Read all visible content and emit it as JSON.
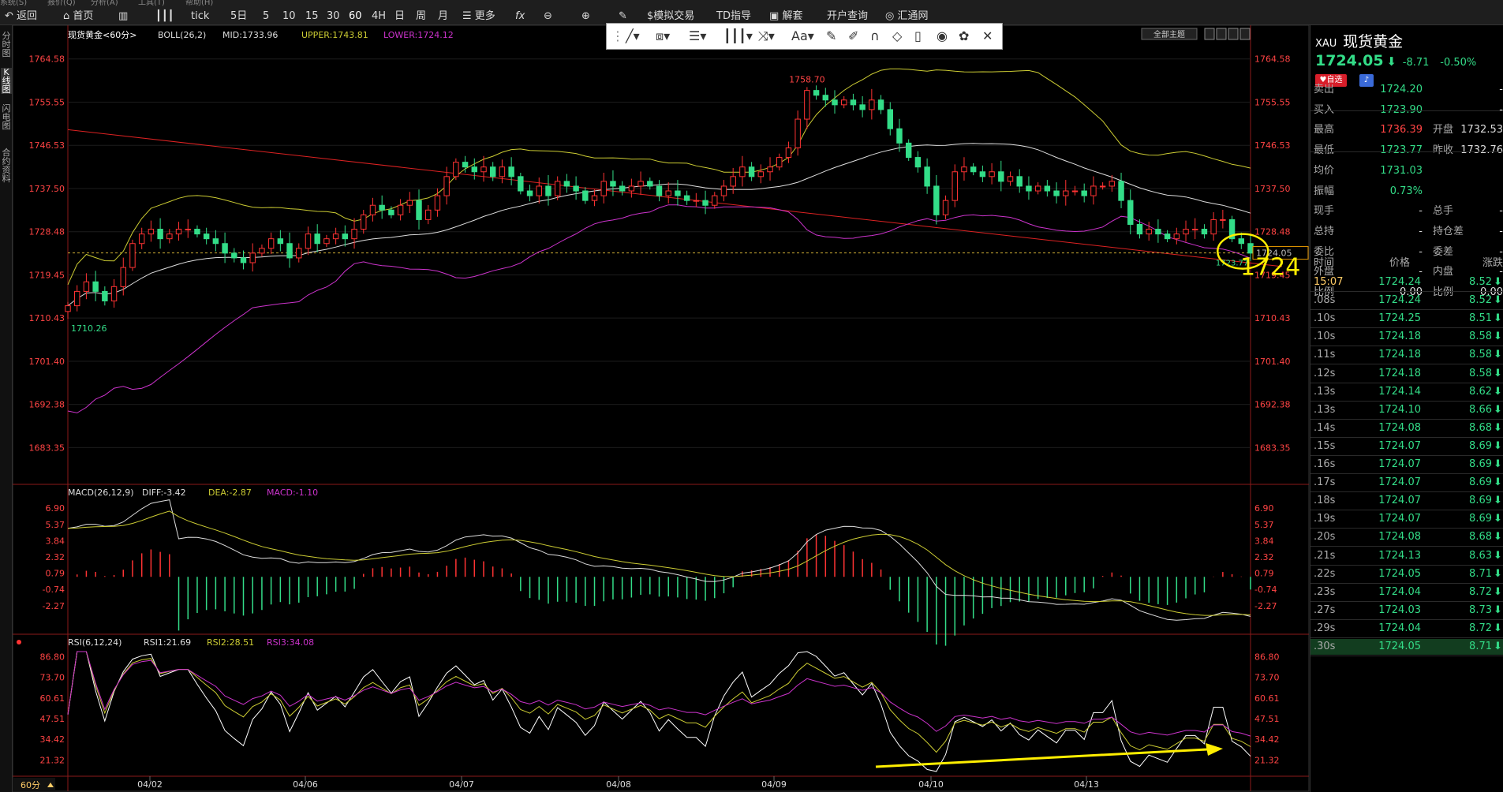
{
  "toolbar": {
    "menu_fragments": [
      "系统(S)",
      "报价(Q)",
      "分析(A)",
      "工具(T)",
      "帮助(H)"
    ],
    "back": "返回",
    "home": "首页",
    "tick": "tick",
    "periods": [
      "5日",
      "5",
      "10",
      "15",
      "30",
      "60",
      "4H",
      "日",
      "周",
      "月"
    ],
    "more": "更多",
    "fx": "fx",
    "sim_trade": "$模拟交易",
    "td": "TD指导",
    "unlock": "解套",
    "open_account": "开户查询",
    "brand": "汇通网"
  },
  "side_tabs": [
    "分时图",
    "K线图",
    "闪电图",
    "合约资料"
  ],
  "chart_data": {
    "type": "candlestick",
    "symbol": "现货黄金<60分>",
    "boll": {
      "label": "BOLL(26,2)",
      "mid": "MID:1733.96",
      "upper": "UPPER:1743.81",
      "lower": "LOWER:1724.12"
    },
    "ylim": [
      1676,
      1768
    ],
    "price_ticks": [
      "1764.58",
      "1755.55",
      "1746.53",
      "1737.50",
      "1728.48",
      "1719.45",
      "1710.43",
      "1701.40",
      "1692.38",
      "1683.35"
    ],
    "x_labels": [
      "04/02",
      "04/06",
      "04/07",
      "04/08",
      "04/09",
      "04/10",
      "04/13"
    ],
    "high_label": "1758.70",
    "low_label": "1710.26",
    "recent_low_label": "1723.77",
    "last_price_box": "1724.05",
    "annotation": "1724",
    "theme_button": "全部主题",
    "closes": [
      1713,
      1716,
      1718,
      1716,
      1714,
      1717,
      1721,
      1726,
      1728,
      1729,
      1727,
      1728,
      1729,
      1729,
      1728,
      1727,
      1726,
      1724,
      1723,
      1722,
      1724,
      1725,
      1727,
      1726,
      1723,
      1725,
      1728,
      1726,
      1727,
      1728,
      1727,
      1729,
      1732,
      1734,
      1733,
      1732,
      1734,
      1735,
      1731,
      1733,
      1736,
      1740,
      1743,
      1742,
      1741,
      1742,
      1740,
      1742,
      1740,
      1737,
      1736,
      1738,
      1736,
      1739,
      1738,
      1737,
      1735,
      1736,
      1739,
      1738,
      1737,
      1738,
      1739,
      1738,
      1736,
      1737,
      1736,
      1735,
      1735,
      1734,
      1736,
      1738,
      1740,
      1742,
      1740,
      1741,
      1742,
      1744,
      1746,
      1752,
      1758,
      1757,
      1756,
      1755,
      1756,
      1755,
      1754,
      1756,
      1754,
      1750,
      1747,
      1744,
      1742,
      1738,
      1732,
      1735,
      1741,
      1742,
      1741,
      1740,
      1741,
      1739,
      1740,
      1738,
      1737,
      1738,
      1737,
      1736,
      1737,
      1737,
      1736,
      1738,
      1738,
      1739,
      1735,
      1730,
      1728,
      1729,
      1728,
      1727,
      1728,
      1729,
      1729,
      1728,
      1731,
      1731,
      1727,
      1726,
      1724
    ],
    "macd": {
      "label": "MACD(26,12,9)",
      "diff": "DIFF:-3.42",
      "dea": "DEA:-2.87",
      "macd": "MACD:-1.10",
      "ylim": [
        -4.8,
        7.8
      ],
      "ticks": [
        "6.90",
        "5.37",
        "3.84",
        "2.32",
        "0.79",
        "-0.74",
        "-2.27"
      ]
    },
    "rsi": {
      "label": "RSI(6,12,24)",
      "rsi1": "RSI1:21.69",
      "rsi2": "RSI2:28.51",
      "rsi3": "RSI3:34.08",
      "ylim": [
        12,
        92
      ],
      "ticks": [
        "86.80",
        "73.70",
        "60.61",
        "47.51",
        "34.42",
        "21.32"
      ]
    },
    "period_label": "60分"
  },
  "quote": {
    "code": "XAU",
    "name": "现货黄金",
    "price": "1724.05",
    "change": "-8.71",
    "pct": "-0.50%",
    "fav": "自选",
    "rows": [
      {
        "l": "卖出",
        "v": "1724.20",
        "l2": "",
        "v2": "-"
      },
      {
        "l": "买入",
        "v": "1723.90",
        "l2": "",
        "v2": "-"
      },
      {
        "l": "最高",
        "v": "1736.39",
        "l2": "开盘",
        "v2": "1732.53"
      },
      {
        "l": "最低",
        "v": "1723.77",
        "l2": "昨收",
        "v2": "1732.76"
      },
      {
        "l": "均价",
        "v": "1731.03",
        "l2": "",
        "v2": ""
      },
      {
        "l": "振幅",
        "v": "0.73%",
        "l2": "",
        "v2": ""
      },
      {
        "l": "现手",
        "v": "-",
        "l2": "总手",
        "v2": "-"
      },
      {
        "l": "总持",
        "v": "-",
        "l2": "持仓差",
        "v2": "-"
      },
      {
        "l": "委比",
        "v": "-",
        "l2": "委差",
        "v2": "-"
      },
      {
        "l": "外盘",
        "v": "-",
        "l2": "内盘",
        "v2": "-"
      },
      {
        "l": "比例",
        "v": "0.00",
        "l2": "比例",
        "v2": "0.00"
      }
    ],
    "tick_header": {
      "t": "时间",
      "p": "价格",
      "c": "涨跌"
    },
    "ticks": [
      {
        "t": "15:07",
        "p": "1724.24",
        "c": "8.52"
      },
      {
        "t": ".08s",
        "p": "1724.24",
        "c": "8.52"
      },
      {
        "t": ".10s",
        "p": "1724.25",
        "c": "8.51"
      },
      {
        "t": ".10s",
        "p": "1724.18",
        "c": "8.58"
      },
      {
        "t": ".11s",
        "p": "1724.18",
        "c": "8.58"
      },
      {
        "t": ".12s",
        "p": "1724.18",
        "c": "8.58"
      },
      {
        "t": ".13s",
        "p": "1724.14",
        "c": "8.62"
      },
      {
        "t": ".13s",
        "p": "1724.10",
        "c": "8.66"
      },
      {
        "t": ".14s",
        "p": "1724.08",
        "c": "8.68"
      },
      {
        "t": ".15s",
        "p": "1724.07",
        "c": "8.69"
      },
      {
        "t": ".16s",
        "p": "1724.07",
        "c": "8.69"
      },
      {
        "t": ".17s",
        "p": "1724.07",
        "c": "8.69"
      },
      {
        "t": ".18s",
        "p": "1724.07",
        "c": "8.69"
      },
      {
        "t": ".19s",
        "p": "1724.07",
        "c": "8.69"
      },
      {
        "t": ".20s",
        "p": "1724.08",
        "c": "8.68"
      },
      {
        "t": ".21s",
        "p": "1724.13",
        "c": "8.63"
      },
      {
        "t": ".22s",
        "p": "1724.05",
        "c": "8.71"
      },
      {
        "t": ".23s",
        "p": "1724.04",
        "c": "8.72"
      },
      {
        "t": ".27s",
        "p": "1724.03",
        "c": "8.73"
      },
      {
        "t": ".29s",
        "p": "1724.04",
        "c": "8.72"
      },
      {
        "t": ".30s",
        "p": "1724.05",
        "c": "8.71"
      }
    ]
  },
  "colors": {
    "up": "#ff3333",
    "down": "#33dd88",
    "upper": "#cccc33",
    "mid": "#dddddd",
    "lower": "#cc33cc",
    "highlight": "#ffee00"
  }
}
